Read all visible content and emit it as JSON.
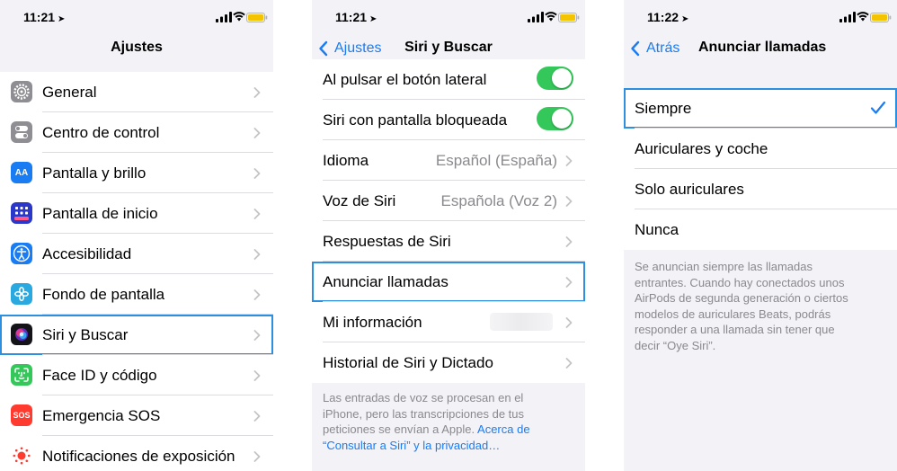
{
  "colors": {
    "accent": "#1b7cf2",
    "toggle_on": "#34c759",
    "highlight": "#2c8fe0"
  },
  "screen1": {
    "time": "11:21",
    "title": "Ajustes",
    "items": [
      {
        "label": "General",
        "icon": "gear-icon"
      },
      {
        "label": "Centro de control",
        "icon": "switches-icon"
      },
      {
        "label": "Pantalla y brillo",
        "icon": "text-size-icon"
      },
      {
        "label": "Pantalla de inicio",
        "icon": "app-grid-icon"
      },
      {
        "label": "Accesibilidad",
        "icon": "accessibility-icon"
      },
      {
        "label": "Fondo de pantalla",
        "icon": "flower-icon"
      },
      {
        "label": "Siri y Buscar",
        "icon": "siri-icon"
      },
      {
        "label": "Face ID y código",
        "icon": "face-id-icon"
      },
      {
        "label": "Emergencia SOS",
        "icon": "sos-icon"
      },
      {
        "label": "Notificaciones de exposición",
        "icon": "exposure-icon"
      }
    ],
    "sos_text": "SOS",
    "aa_text": "AA"
  },
  "screen2": {
    "time": "11:21",
    "back": "Ajustes",
    "title": "Siri y Buscar",
    "rows": [
      {
        "label": "Al pulsar el botón lateral"
      },
      {
        "label": "Siri con pantalla bloqueada"
      },
      {
        "label": "Idioma",
        "value": "Español (España)"
      },
      {
        "label": "Voz de Siri",
        "value": "Española (Voz 2)"
      },
      {
        "label": "Respuestas de Siri"
      },
      {
        "label": "Anunciar llamadas"
      },
      {
        "label": "Mi información"
      },
      {
        "label": "Historial de Siri y Dictado"
      }
    ],
    "footer_l1": "Las entradas de voz se procesan en el",
    "footer_l2": "iPhone, pero las transcripciones de tus",
    "footer_l3": "peticiones se envían a Apple.",
    "footer_link1": "Acerca de",
    "footer_link2": "“Consultar a Siri” y la privacidad…"
  },
  "screen3": {
    "time": "11:22",
    "back": "Atrás",
    "title": "Anunciar llamadas",
    "options": [
      {
        "label": "Siempre"
      },
      {
        "label": "Auriculares y coche"
      },
      {
        "label": "Solo auriculares"
      },
      {
        "label": "Nunca"
      }
    ],
    "footer": [
      "Se anuncian siempre las llamadas",
      "entrantes. Cuando hay conectados unos",
      "AirPods de segunda generación o ciertos",
      "modelos de auriculares Beats, podrás",
      "responder a una llamada sin tener que",
      "decir “Oye Siri”."
    ]
  }
}
